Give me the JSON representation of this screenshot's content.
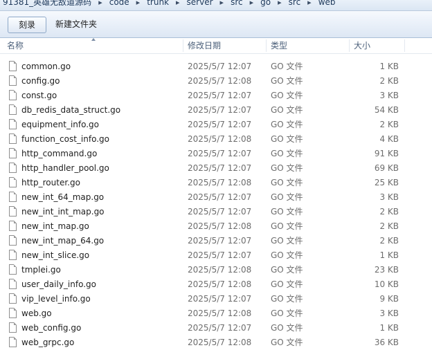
{
  "breadcrumb": [
    "91381_英雄无敌道源码",
    "code",
    "trunk",
    "server",
    "src",
    "go",
    "src",
    "web"
  ],
  "toolbar": {
    "burn_label": "刻录",
    "new_folder_label": "新建文件夹"
  },
  "columns": {
    "name": "名称",
    "modified": "修改日期",
    "type": "类型",
    "size": "大小"
  },
  "files": [
    {
      "name": "common.go",
      "date": "2025/5/7 12:07",
      "type": "GO 文件",
      "size": "1 KB"
    },
    {
      "name": "config.go",
      "date": "2025/5/7 12:08",
      "type": "GO 文件",
      "size": "2 KB"
    },
    {
      "name": "const.go",
      "date": "2025/5/7 12:07",
      "type": "GO 文件",
      "size": "3 KB"
    },
    {
      "name": "db_redis_data_struct.go",
      "date": "2025/5/7 12:07",
      "type": "GO 文件",
      "size": "54 KB"
    },
    {
      "name": "equipment_info.go",
      "date": "2025/5/7 12:07",
      "type": "GO 文件",
      "size": "2 KB"
    },
    {
      "name": "function_cost_info.go",
      "date": "2025/5/7 12:08",
      "type": "GO 文件",
      "size": "4 KB"
    },
    {
      "name": "http_command.go",
      "date": "2025/5/7 12:07",
      "type": "GO 文件",
      "size": "91 KB"
    },
    {
      "name": "http_handler_pool.go",
      "date": "2025/5/7 12:07",
      "type": "GO 文件",
      "size": "69 KB"
    },
    {
      "name": "http_router.go",
      "date": "2025/5/7 12:08",
      "type": "GO 文件",
      "size": "25 KB"
    },
    {
      "name": "new_int_64_map.go",
      "date": "2025/5/7 12:07",
      "type": "GO 文件",
      "size": "3 KB"
    },
    {
      "name": "new_int_int_map.go",
      "date": "2025/5/7 12:07",
      "type": "GO 文件",
      "size": "2 KB"
    },
    {
      "name": "new_int_map.go",
      "date": "2025/5/7 12:08",
      "type": "GO 文件",
      "size": "2 KB"
    },
    {
      "name": "new_int_map_64.go",
      "date": "2025/5/7 12:07",
      "type": "GO 文件",
      "size": "2 KB"
    },
    {
      "name": "new_int_slice.go",
      "date": "2025/5/7 12:07",
      "type": "GO 文件",
      "size": "1 KB"
    },
    {
      "name": "tmplei.go",
      "date": "2025/5/7 12:08",
      "type": "GO 文件",
      "size": "23 KB"
    },
    {
      "name": "user_daily_info.go",
      "date": "2025/5/7 12:08",
      "type": "GO 文件",
      "size": "10 KB"
    },
    {
      "name": "vip_level_info.go",
      "date": "2025/5/7 12:07",
      "type": "GO 文件",
      "size": "9 KB"
    },
    {
      "name": "web.go",
      "date": "2025/5/7 12:08",
      "type": "GO 文件",
      "size": "3 KB"
    },
    {
      "name": "web_config.go",
      "date": "2025/5/7 12:07",
      "type": "GO 文件",
      "size": "1 KB"
    },
    {
      "name": "web_grpc.go",
      "date": "2025/5/7 12:08",
      "type": "GO 文件",
      "size": "36 KB"
    }
  ]
}
